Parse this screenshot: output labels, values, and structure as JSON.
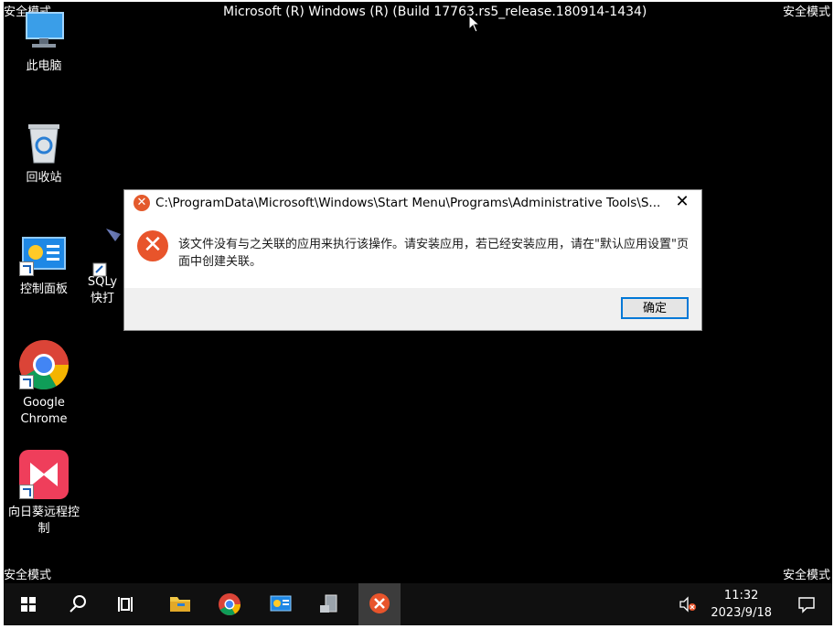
{
  "safe_mode_label": "安全模式",
  "build_text": "Microsoft (R) Windows (R) (Build 17763.rs5_release.180914-1434)",
  "desktop_icons": [
    {
      "label": "此电脑",
      "icon": "computer-icon"
    },
    {
      "label": "回收站",
      "icon": "recycle-bin-icon"
    },
    {
      "label": "控制面板",
      "icon": "control-panel-icon"
    },
    {
      "label": "SQLy",
      "label2": "快打",
      "icon": "sqlyog-icon"
    },
    {
      "label": "Google",
      "label2": "Chrome",
      "icon": "chrome-icon"
    },
    {
      "label": "向日葵远程控",
      "label2": "制",
      "icon": "sunlogin-icon"
    }
  ],
  "dialog": {
    "title": "C:\\ProgramData\\Microsoft\\Windows\\Start Menu\\Programs\\Administrative Tools\\S...",
    "close_glyph": "✕",
    "message": "该文件没有与之关联的应用来执行该操作。请安装应用，若已经安装应用，请在\"默认应用设置\"页面中创建关联。",
    "ok_label": "确定",
    "error_glyph": "✕"
  },
  "taskbar": {
    "time": "11:32",
    "date": "2023/9/18"
  },
  "colors": {
    "desktop": "#000000",
    "accent": "#0078d7",
    "error": "#e8542b"
  }
}
